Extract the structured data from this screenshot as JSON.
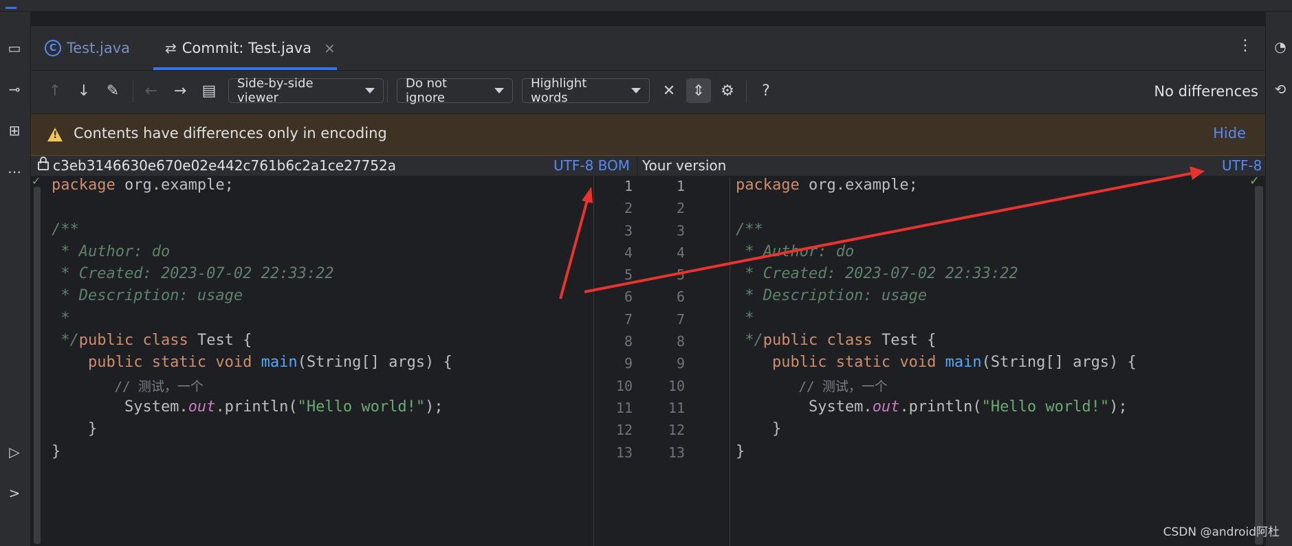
{
  "tabs": [
    {
      "label": "Test.java",
      "icon": "class-c-icon"
    },
    {
      "label": "Commit: Test.java",
      "icon": "commit-compare-icon",
      "close": "×"
    }
  ],
  "toolbar": {
    "viewer": "Side-by-side viewer",
    "ignore": "Do not ignore",
    "highlight": "Highlight words",
    "status": "No differences",
    "help": "?"
  },
  "banner": {
    "message": "Contents have differences only in encoding",
    "action": "Hide"
  },
  "left_header": {
    "revision": "c3eb3146630e670e02e442c761b6c2a1ce27752a",
    "encoding": "UTF-8 BOM"
  },
  "right_header": {
    "title": "Your version",
    "encoding": "UTF-8"
  },
  "line_numbers": [
    "1",
    "2",
    "3",
    "4",
    "5",
    "6",
    "7",
    "8",
    "9",
    "10",
    "11",
    "12",
    "13"
  ],
  "code": {
    "l1_kw": "package",
    "l1_rest": " org.example;",
    "l3": "/**",
    "l4": " * Author: do",
    "l5": " * Created: 2023-07-02 22:33:22",
    "l6": " * Description: usage",
    "l7": " *",
    "l8_cm": " */",
    "l8_kw": "public class",
    "l8_rest": " Test {",
    "l9_kw": "    public static void ",
    "l9_fn": "main",
    "l9_rest": "(String[] args) {",
    "l10": "        // 测试，一个",
    "l11_a": "        System.",
    "l11_fld": "out",
    "l11_b": ".println(",
    "l11_str": "\"Hello world!\"",
    "l11_c": ");",
    "l12": "    }",
    "l13": "}"
  },
  "watermark": "CSDN @android阿杜",
  "colors": {
    "accent": "#3574f0",
    "link": "#548af7",
    "warning_bg": "#3d3223",
    "keyword": "#cf8e6d",
    "comment": "#5f826b",
    "string": "#6aab73",
    "arrow": "#e8332f"
  }
}
